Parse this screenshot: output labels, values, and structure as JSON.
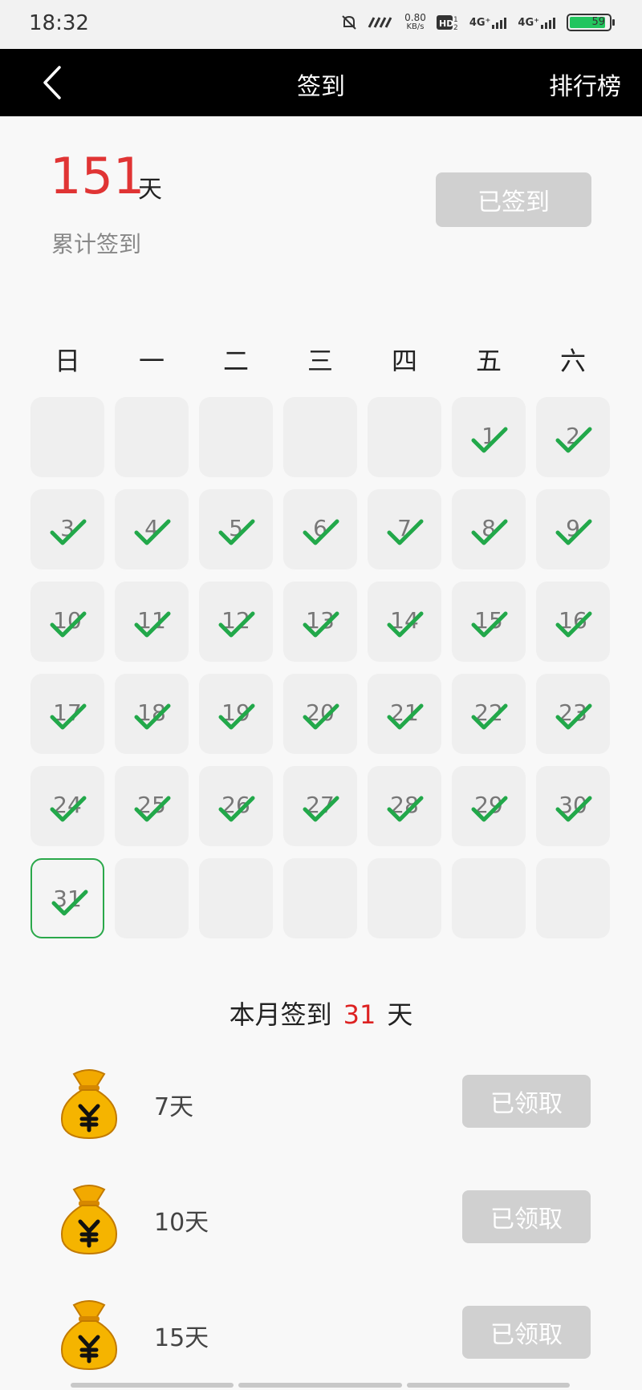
{
  "status_bar": {
    "time": "18:32",
    "speed_value": "0.80",
    "speed_unit": "KB/s",
    "network_1": "4G⁺",
    "network_2": "4G⁺",
    "battery_level": "59"
  },
  "nav": {
    "back_icon": "chevron-left-icon",
    "title": "签到",
    "right_label": "排行榜"
  },
  "summary": {
    "total_days": "151",
    "unit": "天",
    "label": "累计签到",
    "signed_button": "已签到"
  },
  "calendar": {
    "weekdays": [
      "日",
      "一",
      "二",
      "三",
      "四",
      "五",
      "六"
    ],
    "first_weekday_index": 5,
    "days_in_month": 31,
    "checked_days": [
      1,
      2,
      3,
      4,
      5,
      6,
      7,
      8,
      9,
      10,
      11,
      12,
      13,
      14,
      15,
      16,
      17,
      18,
      19,
      20,
      21,
      22,
      23,
      24,
      25,
      26,
      27,
      28,
      29,
      30,
      31
    ],
    "today": 31,
    "check_color": "#22a84a",
    "today_border_color": "#2aa84a"
  },
  "month_summary": {
    "prefix": "本月签到",
    "count": "31",
    "suffix": "天"
  },
  "rewards": [
    {
      "icon": "money-bag-icon",
      "days": "7天",
      "button": "已领取"
    },
    {
      "icon": "money-bag-icon",
      "days": "10天",
      "button": "已领取"
    },
    {
      "icon": "money-bag-icon",
      "days": "15天",
      "button": "已领取"
    }
  ],
  "colors": {
    "accent_red": "#e03434",
    "nav_background": "#000000",
    "disabled_button": "#d0d0d0"
  }
}
